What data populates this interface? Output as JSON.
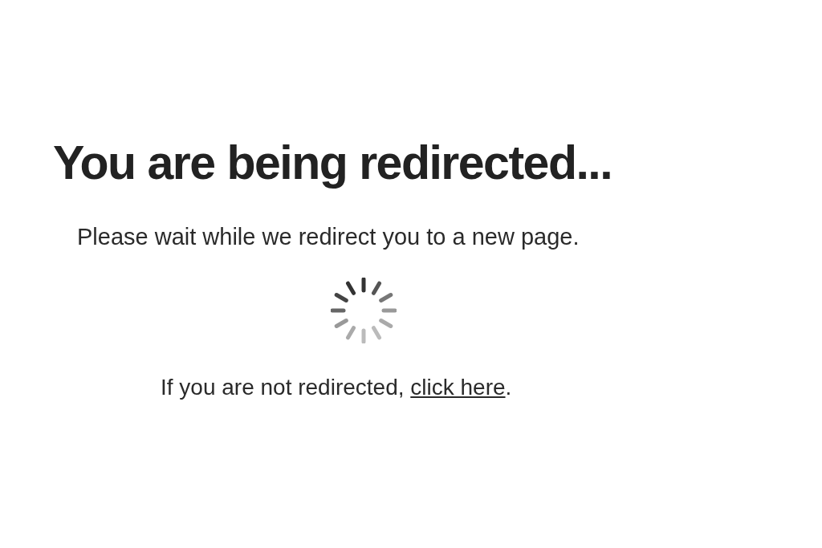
{
  "heading": "You are being redirected...",
  "message": "Please wait while we redirect you to a new page.",
  "fallback": {
    "text": "If you are not redirected, ",
    "link": "click here",
    "after": "."
  }
}
